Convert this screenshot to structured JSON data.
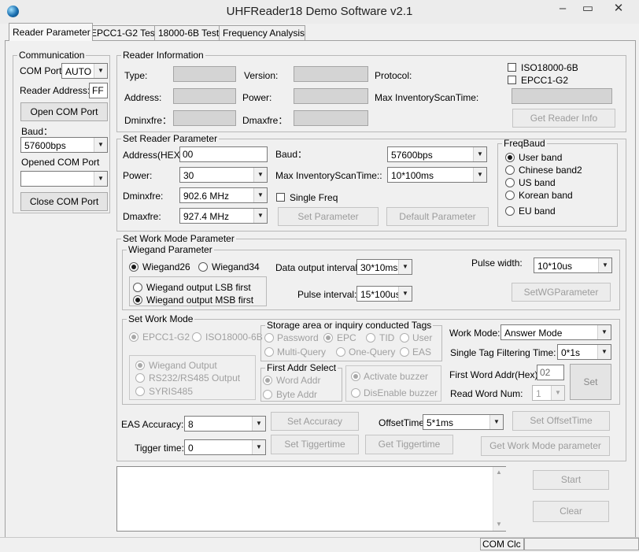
{
  "window": {
    "title": "UHFReader18 Demo Software v2.1",
    "minimize": "–",
    "maximize": "▭",
    "close": "✕"
  },
  "tabs": [
    "Reader Parameter",
    "EPCC1-G2 Test",
    "18000-6B Test",
    "Frequency Analysis"
  ],
  "communication": {
    "legend": "Communication",
    "com_port_label": "COM Port:",
    "com_port_value": "AUTO",
    "reader_address_label": "Reader Address:",
    "reader_address_value": "FF",
    "open_button": "Open COM Port",
    "baud_label": "Baud：",
    "baud_value": "57600bps",
    "opened_label": "Opened COM Port",
    "opened_value": "",
    "close_button": "Close COM Port"
  },
  "reader_info": {
    "legend": "Reader Information",
    "type_label": "Type:",
    "version_label": "Version:",
    "protocol_label": "Protocol:",
    "address_label": "Address:",
    "power_label": "Power:",
    "max_scan_label": "Max InventoryScanTime:",
    "dminxfre_label": "Dminxfre：",
    "dmaxfre_label": "Dmaxfre：",
    "iso_label": "ISO18000-6B",
    "epc_label": "EPCC1-G2",
    "get_button": "Get Reader Info"
  },
  "set_reader": {
    "legend": "Set Reader Parameter",
    "address_label": "Address(HEX):",
    "address_value": "00",
    "baud_label": "Baud：",
    "baud_value": "57600bps",
    "power_label": "Power:",
    "power_value": "30",
    "max_scan_label": "Max InventoryScanTime::",
    "max_scan_value": "10*100ms",
    "dminxfre_label": "Dminxfre:",
    "dminxfre_value": "902.6 MHz",
    "single_freq_label": "Single Freq",
    "dmaxfre_label": "Dmaxfre:",
    "dmaxfre_value": "927.4 MHz",
    "set_button": "Set Parameter",
    "default_button": "Default Parameter"
  },
  "freq_band": {
    "legend": "FreqBaud",
    "options": [
      "User band",
      "Chinese band2",
      "US band",
      "Korean band",
      "EU band"
    ],
    "selected": 0
  },
  "work_mode": {
    "legend": "Set Work Mode Parameter",
    "wiegand": {
      "legend": "Wiegand Parameter",
      "wiegand26": "Wiegand26",
      "wiegand34": "Wiegand34",
      "lsb": "Wiegand output LSB first",
      "msb": "Wiegand output MSB first",
      "data_interval_label": "Data output interval:",
      "data_interval_value": "30*10ms",
      "pulse_width_label": "Pulse width:",
      "pulse_width_value": "10*10us",
      "pulse_interval_label": "Pulse interval:",
      "pulse_interval_value": "15*100us",
      "set_button": "SetWGParameter"
    },
    "mode": {
      "legend": "Set Work Mode",
      "epc": "EPCC1-G2",
      "iso": "ISO18000-6B",
      "wiegand_output": "Wiegand Output",
      "rs232": "RS232/RS485 Output",
      "syris": "SYRIS485"
    },
    "storage": {
      "legend": "Storage area or inquiry conducted Tags",
      "password": "Password",
      "epc": "EPC",
      "tid": "TID",
      "user": "User",
      "multi": "Multi-Query",
      "one": "One-Query",
      "eas": "EAS"
    },
    "first_addr": {
      "legend": "First Addr Select",
      "word": "Word Addr",
      "byte": "Byte Addr"
    },
    "buzzer": {
      "activate": "Activate buzzer",
      "disenable": "DisEnable buzzer"
    },
    "work_mode_label": "Work Mode:",
    "work_mode_value": "Answer Mode",
    "single_filter_label": "Single Tag Filtering Time:",
    "single_filter_value": "0*1s",
    "first_word_label": "First Word Addr(Hex):",
    "first_word_value": "02",
    "read_word_label": "Read Word Num:",
    "read_word_value": "1",
    "set_button": "Set"
  },
  "eas": {
    "accuracy_label": "EAS Accuracy:",
    "accuracy_value": "8",
    "set_accuracy": "Set Accuracy",
    "offset_label": "OffsetTime:",
    "offset_value": "5*1ms",
    "set_offset": "Set OffsetTime",
    "tigger_label": "Tigger time:",
    "tigger_value": "0",
    "set_tigger": "Set Tiggertime",
    "get_tigger": "Get Tiggertime",
    "get_work_mode": "Get Work Mode parameter"
  },
  "log": {
    "start": "Start",
    "clear": "Clear",
    "text": ""
  },
  "status": {
    "com_closed": "COM Clc"
  }
}
